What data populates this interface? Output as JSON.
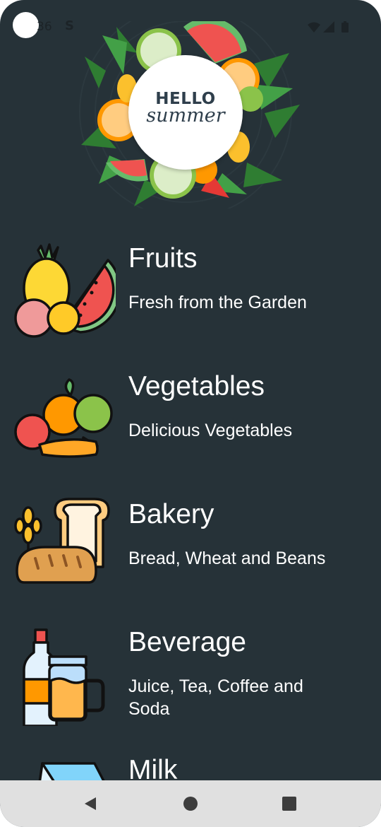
{
  "status_bar": {
    "time": "36",
    "sync_icon": "sync-s-icon",
    "right_icons": [
      "wifi-icon",
      "signal-icon",
      "battery-icon"
    ]
  },
  "hero": {
    "hello": "HELLO",
    "summer": "summer"
  },
  "categories": [
    {
      "title": "Fruits",
      "subtitle": "Fresh from the Garden",
      "icon": "fruits-icon"
    },
    {
      "title": "Vegetables",
      "subtitle": "Delicious Vegetables",
      "icon": "vegetables-icon"
    },
    {
      "title": "Bakery",
      "subtitle": "Bread, Wheat and Beans",
      "icon": "bakery-icon"
    },
    {
      "title": "Beverage",
      "subtitle": "Juice, Tea, Coffee and\n Soda",
      "icon": "beverage-icon"
    },
    {
      "title": "Milk",
      "subtitle": "",
      "icon": "milk-icon"
    }
  ],
  "nav_bar": {
    "buttons": [
      "back-icon",
      "home-icon",
      "recents-icon"
    ]
  },
  "colors": {
    "background": "#263238",
    "text": "#ffffff",
    "nav_bar": "#e0e0e0"
  }
}
